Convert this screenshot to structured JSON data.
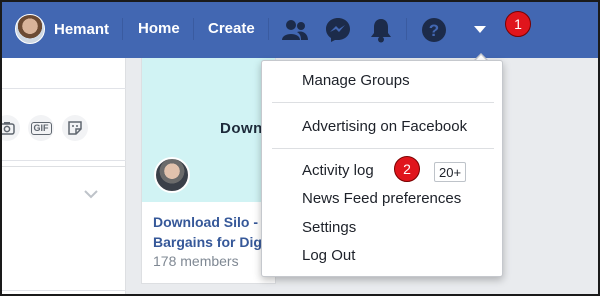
{
  "header": {
    "profile_name": "Hemant",
    "nav": {
      "home": "Home",
      "create": "Create"
    },
    "icons": [
      "friends-icon",
      "messenger-icon",
      "notifications-icon",
      "help-icon",
      "dropdown-arrow-icon"
    ],
    "brand_color": "#4267b2"
  },
  "annotations": {
    "step1": "1",
    "step2": "2",
    "annotation_color": "#e0151c",
    "highlight_color": "#fcfc00"
  },
  "composer": {
    "gif_label": "GIF"
  },
  "group_card": {
    "cover_text": "Down",
    "title_line1": "Download Silo -",
    "title_line2": "Bargains for Dig",
    "members": "178 members"
  },
  "menu": {
    "manage_groups": "Manage Groups",
    "advertising": "Advertising on Facebook",
    "activity_log": "Activity log",
    "activity_count": "20+",
    "news_feed_prefs": "News Feed preferences",
    "settings": "Settings",
    "log_out": "Log Out"
  }
}
